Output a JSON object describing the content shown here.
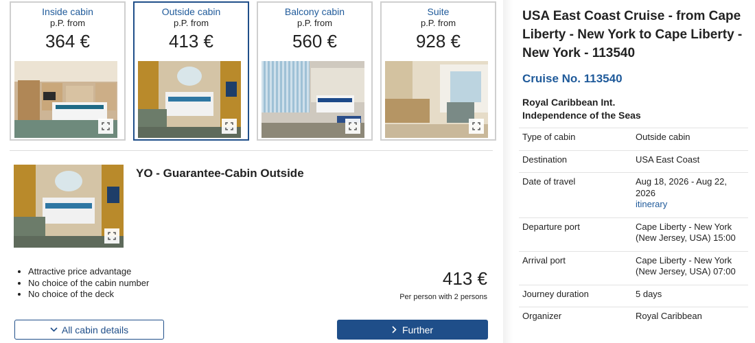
{
  "cabin_categories": [
    {
      "name": "Inside cabin",
      "from": "p.P. from",
      "price": "364 €"
    },
    {
      "name": "Outside cabin",
      "from": "p.P. from",
      "price": "413 €"
    },
    {
      "name": "Balcony cabin",
      "from": "p.P. from",
      "price": "560 €"
    },
    {
      "name": "Suite",
      "from": "p.P. from",
      "price": "928 €"
    }
  ],
  "selected_cabin": {
    "title": "YO - Guarantee-Cabin Outside",
    "features": [
      "Attractive price advantage",
      "No choice of the cabin number",
      "No choice of the deck"
    ],
    "price": "413 €",
    "price_note": "Per person with 2 persons"
  },
  "buttons": {
    "all_details": "All cabin details",
    "further": "Further"
  },
  "cruise": {
    "title": "USA East Coast Cruise - from Cape Liberty - New York to Cape Liberty - New York - 113540",
    "cruise_no": "Cruise No. 113540",
    "line": "Royal Caribbean Int.",
    "ship": "Independence of the Seas",
    "info": [
      {
        "label": "Type of cabin",
        "value": "Outside cabin"
      },
      {
        "label": "Destination",
        "value": "USA East Coast"
      },
      {
        "label": "Date of travel",
        "value": "Aug 18, 2026 - Aug 22, 2026",
        "link": "itinerary"
      },
      {
        "label": "Departure port",
        "value": "Cape Liberty - New York (New Jersey, USA) 15:00"
      },
      {
        "label": "Arrival port",
        "value": "Cape Liberty - New York (New Jersey, USA) 07:00"
      },
      {
        "label": "Journey duration",
        "value": "5 days"
      },
      {
        "label": "Organizer",
        "value": "Royal Caribbean"
      }
    ]
  },
  "colors": {
    "accent": "#1f4e89",
    "link": "#1f5a9a",
    "border": "#cfcfcf"
  }
}
